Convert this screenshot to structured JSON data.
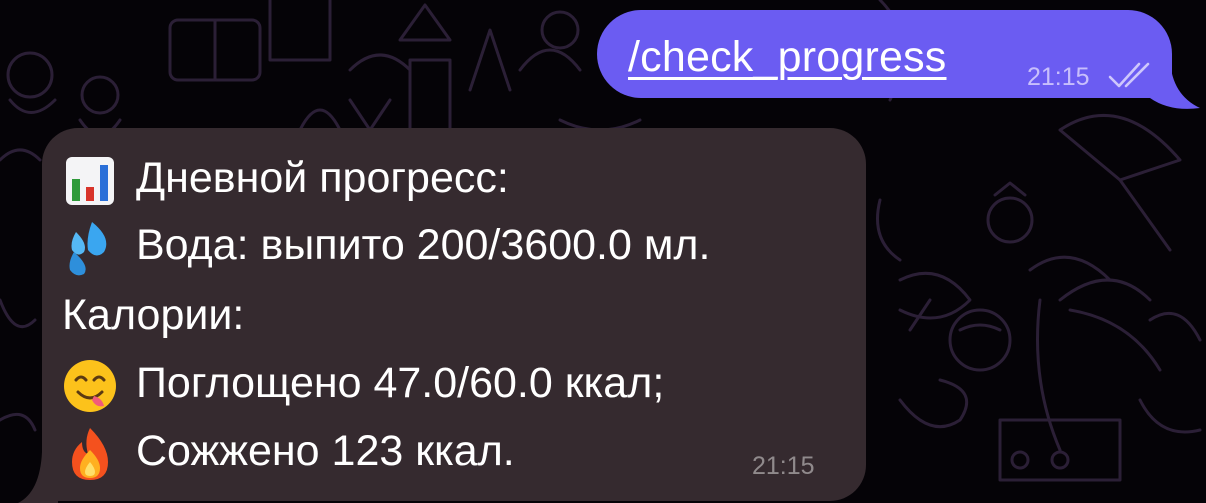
{
  "theme": {
    "background": "#050307",
    "outgoing_bubble": "#6b5cf2",
    "incoming_bubble": "#352a2f",
    "wallpaper_doodle": "#2b1f36"
  },
  "outgoing": {
    "text": "/check_progress",
    "time": "21:15",
    "status_icon": "double-check-icon"
  },
  "incoming": {
    "lines": [
      {
        "icon": "bar-chart-emoji",
        "text": "Дневной прогресс:"
      },
      {
        "icon": "droplets-emoji",
        "text": "Вода: выпито 200/3600.0 мл."
      },
      {
        "icon": "",
        "text": "Калории:"
      },
      {
        "icon": "yum-face-emoji",
        "text": "Поглощено 47.0/60.0 ккал;"
      },
      {
        "icon": "fire-emoji",
        "text": "Сожжено 123 ккал."
      }
    ],
    "time": "21:15"
  }
}
